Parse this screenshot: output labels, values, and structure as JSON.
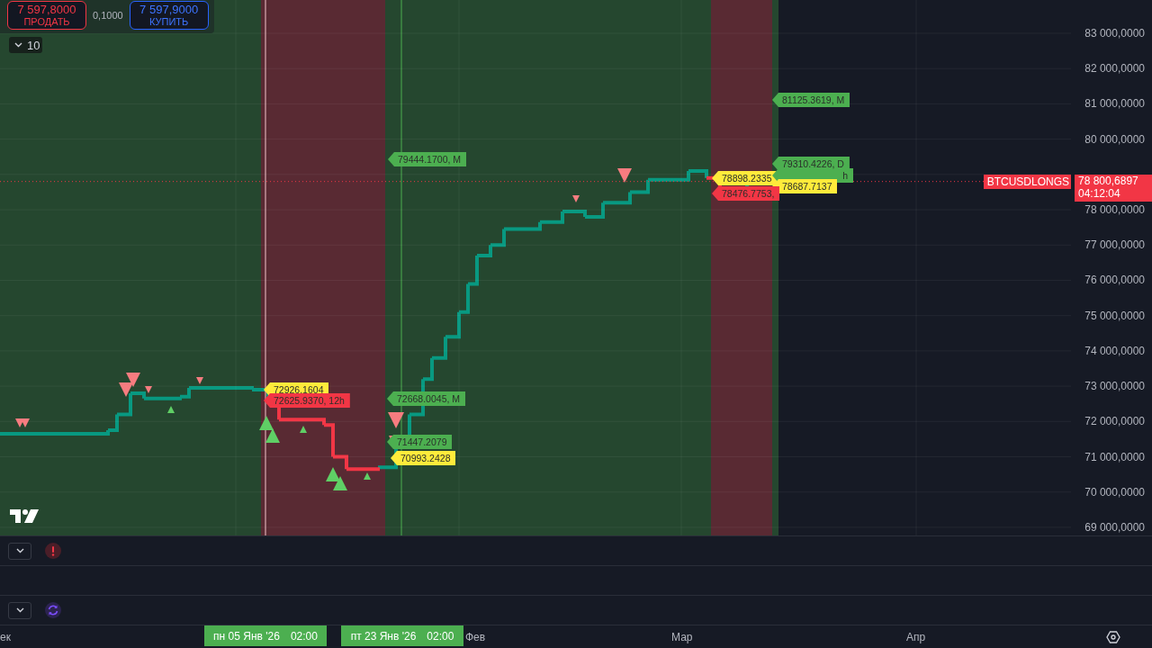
{
  "trade_panel": {
    "sell": {
      "price": "7 597,8000",
      "label": "ПРОДАТЬ"
    },
    "spread": "0,1000",
    "buy": {
      "price": "7 597,9000",
      "label": "КУПИТЬ"
    }
  },
  "interval_button": {
    "label": "10"
  },
  "price_tags": [
    {
      "text": "79444.1700, M",
      "color": "#4caf50"
    },
    {
      "text": "72926.1604",
      "color": "#ffeb3b"
    },
    {
      "text": "72625.9370, 12h",
      "color": "#f23645"
    },
    {
      "text": "72668.0045, M",
      "color": "#4caf50"
    },
    {
      "text": "71447.2079",
      "color": "#4caf50"
    },
    {
      "text": "70993.2428",
      "color": "#ffeb3b"
    },
    {
      "text": "81125.3619, M",
      "color": "#4caf50"
    },
    {
      "text": "78898.2335",
      "color": "#ffeb3b"
    },
    {
      "text": "h",
      "color": "#4caf50"
    },
    {
      "text": "79310.4226, D",
      "color": "#4caf50"
    },
    {
      "text": "78687.7137",
      "color": "#ffeb3b"
    },
    {
      "text": "78476.7753,",
      "color": "#f23645"
    }
  ],
  "price_scale": {
    "labels": [
      "83 000,0000",
      "82 000,0000",
      "81 000,0000",
      "80 000,0000",
      "78 000,0000",
      "77 000,0000",
      "76 000,0000",
      "75 000,0000",
      "74 000,0000",
      "73 000,0000",
      "72 000,0000",
      "71 000,0000",
      "70 000,0000",
      "69 000,0000"
    ]
  },
  "last_price": {
    "symbol": "BTCUSDLONGS",
    "price": "78 800,6897",
    "countdown": "04:12:04"
  },
  "panes": [
    {
      "kind": "alert"
    },
    {
      "kind": "empty"
    },
    {
      "kind": "refresh"
    }
  ],
  "time_scale": {
    "labels": [
      "ек",
      "Фев",
      "Мар",
      "Апр"
    ],
    "crosshair_labels": [
      {
        "date": "пн 05 Янв '26",
        "time": "02:00"
      },
      {
        "date": "пт 23 Янв '26",
        "time": "02:00"
      }
    ]
  }
}
